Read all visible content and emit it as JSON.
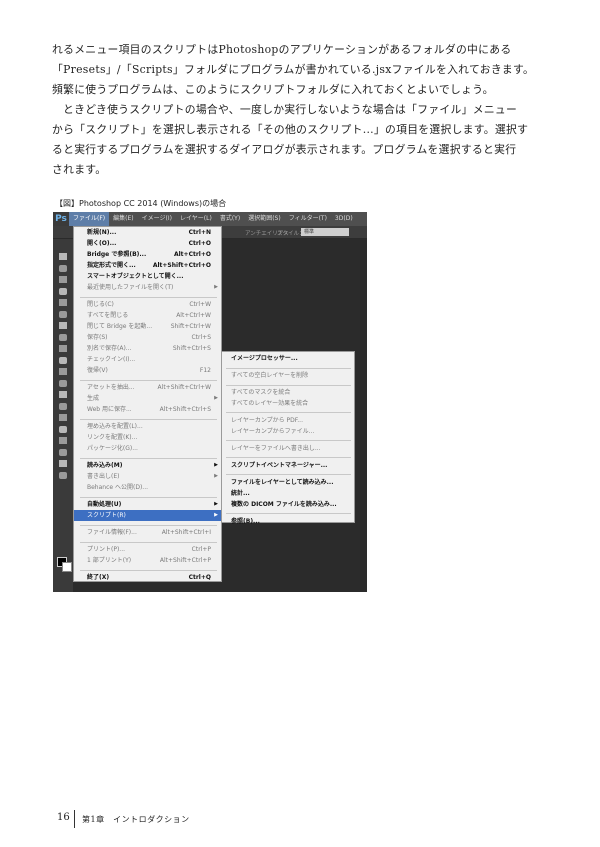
{
  "body": {
    "line1": "れるメニュー項目のスクリプトはPhotoshopのアプリケーションがあるフォルダの中にある",
    "line2": "「Presets」/「Scripts」フォルダにプログラムが書かれている.jsxファイルを入れておきます。",
    "line3": "頻繁に使うプログラムは、このようにスクリプトフォルダに入れておくとよいでしょう。",
    "line4": "ときどき使うスクリプトの場合や、一度しか実行しないような場合は「ファイル」メニュー",
    "line5": "から「スクリプト」を選択し表示される「その他のスクリプト...」の項目を選択します。選択す",
    "line6": "ると実行するプログラムを選択するダイアログが表示されます。プログラムを選択すると実行",
    "line7": "されます。"
  },
  "caption": "【図】Photoshop CC 2014 (Windows)の場合",
  "screenshot": {
    "logo": "Ps",
    "menubar": [
      "ファイル(F)",
      "編集(E)",
      "イメージ(I)",
      "レイヤー(L)",
      "書式(Y)",
      "選択範囲(S)",
      "フィルター(T)",
      "3D(D)"
    ],
    "optbar_antialias": "アンチエイリアス",
    "optbar_style_label": "スタイル：",
    "optbar_style_value": "標準",
    "file_menu": [
      {
        "label": "新規(N)...",
        "shortcut": "Ctrl+N"
      },
      {
        "label": "開く(O)...",
        "shortcut": "Ctrl+O"
      },
      {
        "label": "Bridge で参照(B)...",
        "shortcut": "Alt+Ctrl+O"
      },
      {
        "label": "指定形式で開く...",
        "shortcut": "Alt+Shift+Ctrl+O"
      },
      {
        "label": "スマートオブジェクトとして開く...",
        "shortcut": ""
      },
      {
        "label": "最近使用したファイルを開く(T)",
        "shortcut": ""
      },
      {
        "label": "閉じる(C)",
        "shortcut": "Ctrl+W"
      },
      {
        "label": "すべてを閉じる",
        "shortcut": "Alt+Ctrl+W"
      },
      {
        "label": "閉じて Bridge を起動...",
        "shortcut": "Shift+Ctrl+W"
      },
      {
        "label": "保存(S)",
        "shortcut": "Ctrl+S"
      },
      {
        "label": "別名で保存(A)...",
        "shortcut": "Shift+Ctrl+S"
      },
      {
        "label": "チェックイン(I)...",
        "shortcut": ""
      },
      {
        "label": "復帰(V)",
        "shortcut": "F12"
      },
      {
        "label": "アセットを抽出...",
        "shortcut": "Alt+Shift+Ctrl+W"
      },
      {
        "label": "生成",
        "shortcut": ""
      },
      {
        "label": "Web 用に保存...",
        "shortcut": "Alt+Shift+Ctrl+S"
      },
      {
        "label": "埋め込みを配置(L)...",
        "shortcut": ""
      },
      {
        "label": "リンクを配置(K)...",
        "shortcut": ""
      },
      {
        "label": "パッケージ化(G)...",
        "shortcut": ""
      },
      {
        "label": "読み込み(M)",
        "shortcut": ""
      },
      {
        "label": "書き出し(E)",
        "shortcut": ""
      },
      {
        "label": "Behance へ公開(D)...",
        "shortcut": ""
      },
      {
        "label": "自動処理(U)",
        "shortcut": ""
      },
      {
        "label": "スクリプト(R)",
        "shortcut": ""
      },
      {
        "label": "ファイル情報(F)...",
        "shortcut": "Alt+Shift+Ctrl+I"
      },
      {
        "label": "プリント(P)...",
        "shortcut": "Ctrl+P"
      },
      {
        "label": "1 部プリント(Y)",
        "shortcut": "Alt+Shift+Ctrl+P"
      },
      {
        "label": "終了(X)",
        "shortcut": "Ctrl+Q"
      }
    ],
    "script_submenu": [
      "イメージプロセッサー...",
      "すべての空白レイヤーを削除",
      "すべてのマスクを統合",
      "すべてのレイヤー効果を統合",
      "レイヤーカンプから PDF...",
      "レイヤーカンプからファイル...",
      "レイヤーをファイルへ書き出し...",
      "スクリプトイベントマネージャー...",
      "ファイルをレイヤーとして読み込み...",
      "統計...",
      "複数の DICOM ファイルを読み込み...",
      "参照(B)..."
    ]
  },
  "footer": {
    "page_number": "16",
    "chapter": "第1章　イントロダクション"
  }
}
